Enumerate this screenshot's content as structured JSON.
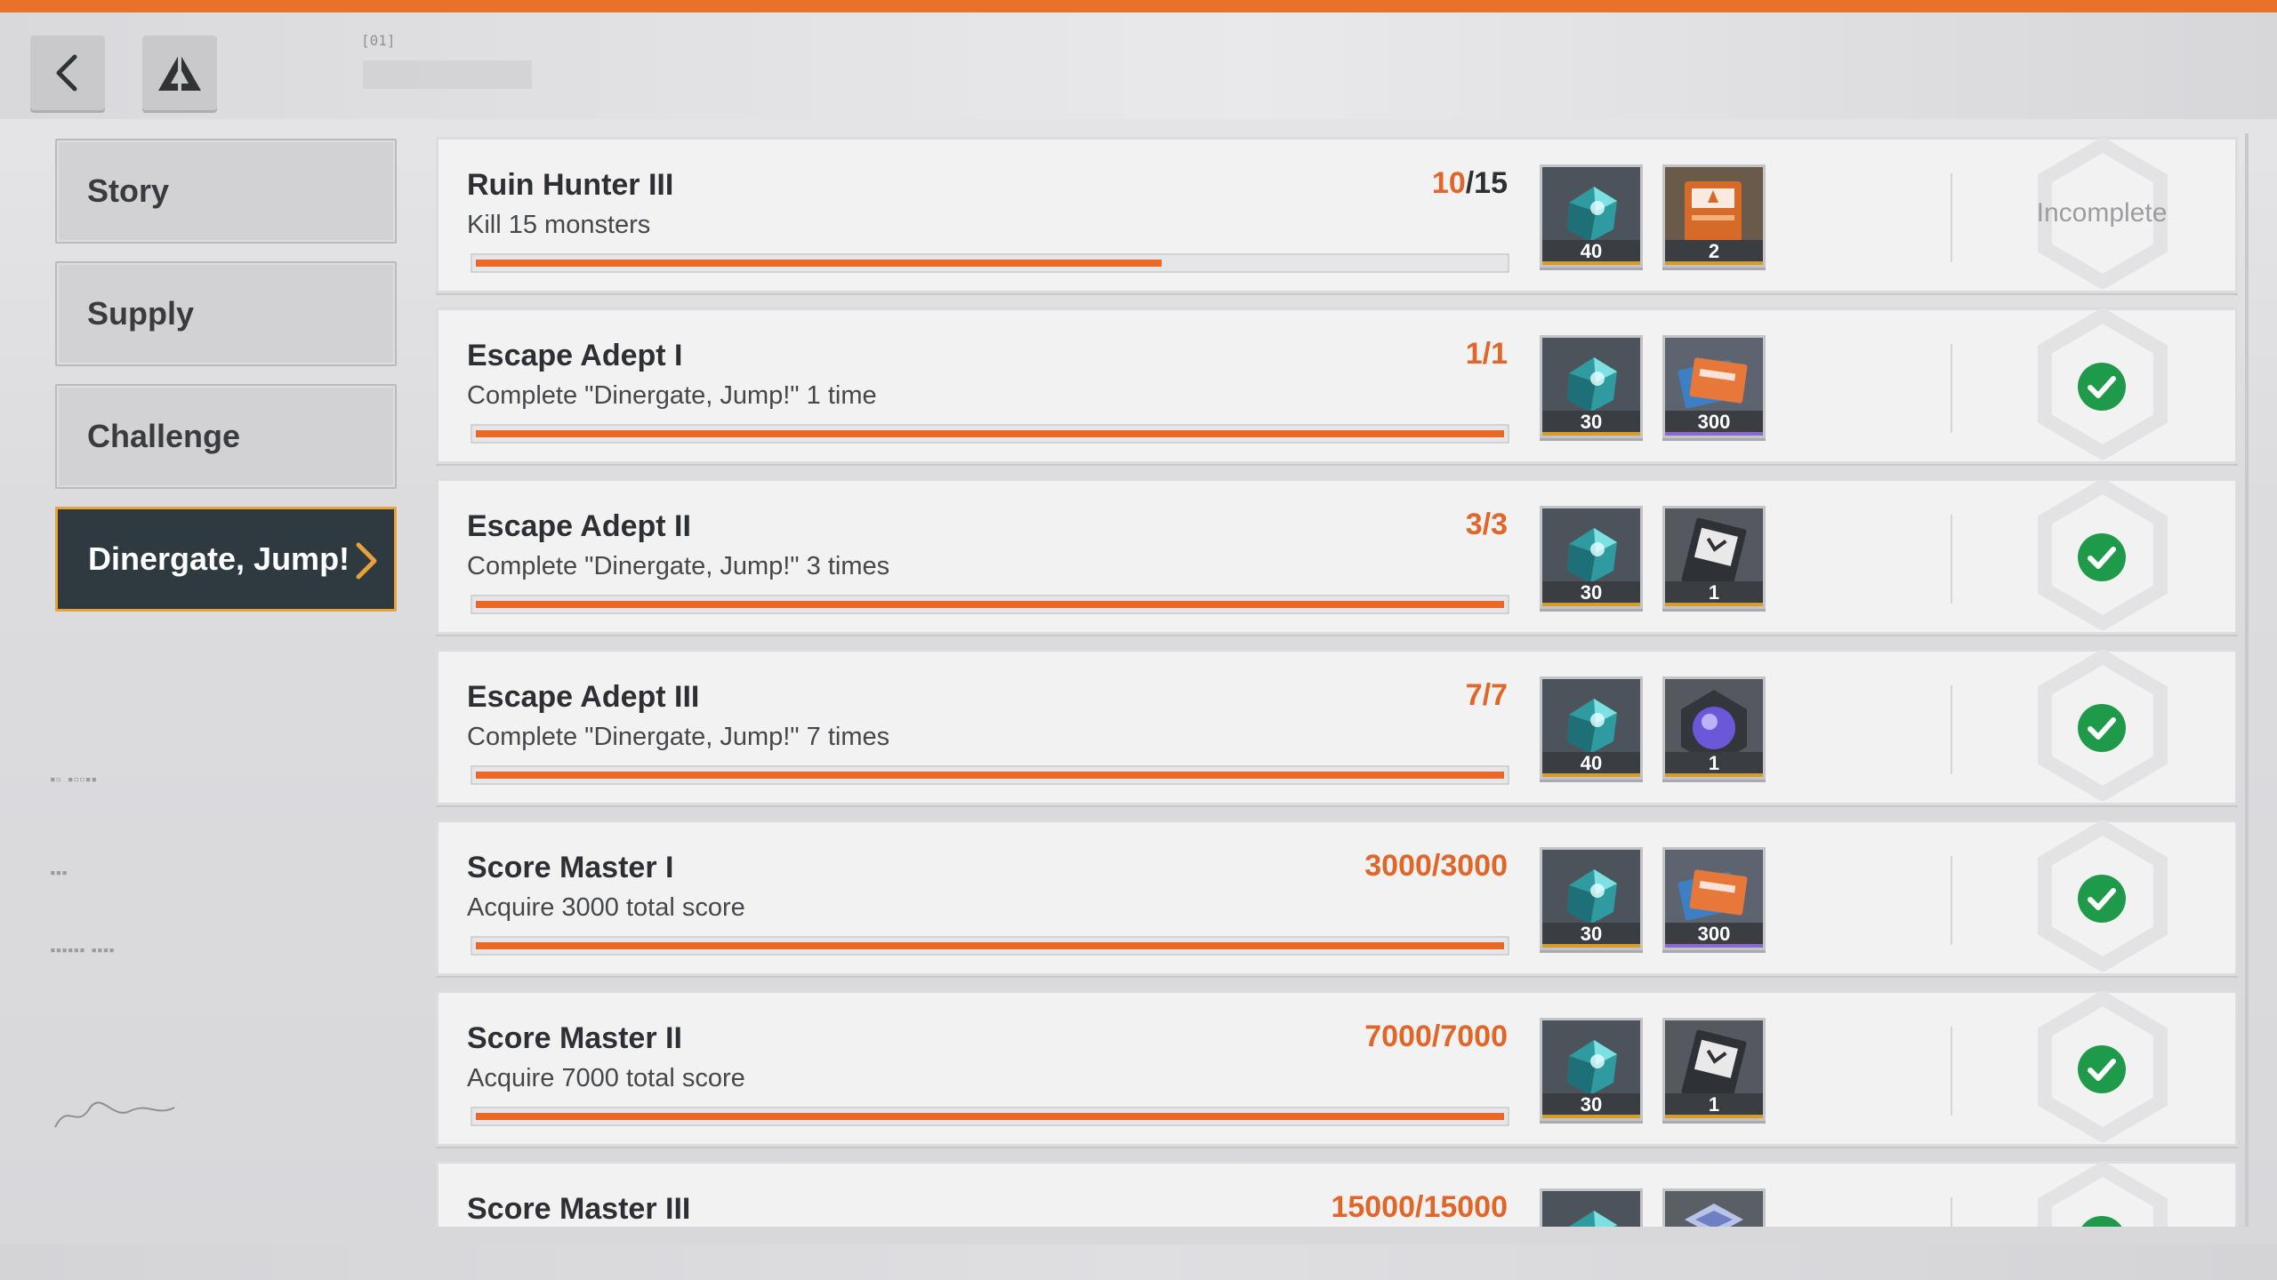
{
  "header": {
    "tag": "[01]"
  },
  "sidebar": {
    "items": [
      {
        "label": "Story",
        "active": false
      },
      {
        "label": "Supply",
        "active": false
      },
      {
        "label": "Challenge",
        "active": false
      },
      {
        "label": "Dinergate, Jump!",
        "active": true
      }
    ]
  },
  "colors": {
    "accent": "#ea6726",
    "complete": "#1f9a4a",
    "active_tab": "#2f3a40",
    "active_border": "#e8a23a"
  },
  "achievements": [
    {
      "title": "Ruin Hunter III",
      "desc": "Kill 15 monsters",
      "current": "10",
      "total": "/15",
      "progress": 0.667,
      "complete": false,
      "rewards": [
        {
          "icon": "crystal-icon",
          "qty": "40"
        },
        {
          "icon": "supply-card-icon",
          "qty": "2"
        }
      ],
      "status": "Incomplete"
    },
    {
      "title": "Escape Adept I",
      "desc": "Complete \"Dinergate, Jump!\" 1 time",
      "current": "1/1",
      "total": "",
      "progress": 1,
      "complete": true,
      "rewards": [
        {
          "icon": "crystal-icon",
          "qty": "30"
        },
        {
          "icon": "ticket-bundle-icon",
          "qty": "300"
        }
      ],
      "status": ""
    },
    {
      "title": "Escape Adept II",
      "desc": "Complete \"Dinergate, Jump!\" 3 times",
      "current": "3/3",
      "total": "",
      "progress": 1,
      "complete": true,
      "rewards": [
        {
          "icon": "crystal-icon",
          "qty": "30"
        },
        {
          "icon": "data-card-icon",
          "qty": "1"
        }
      ],
      "status": ""
    },
    {
      "title": "Escape Adept III",
      "desc": "Complete \"Dinergate, Jump!\" 7 times",
      "current": "7/7",
      "total": "",
      "progress": 1,
      "complete": true,
      "rewards": [
        {
          "icon": "crystal-icon",
          "qty": "40"
        },
        {
          "icon": "core-orb-icon",
          "qty": "1"
        }
      ],
      "status": ""
    },
    {
      "title": "Score Master I",
      "desc": "Acquire 3000 total score",
      "current": "3000/3000",
      "total": "",
      "progress": 1,
      "complete": true,
      "rewards": [
        {
          "icon": "crystal-icon",
          "qty": "30"
        },
        {
          "icon": "ticket-bundle-icon",
          "qty": "300"
        }
      ],
      "status": ""
    },
    {
      "title": "Score Master II",
      "desc": "Acquire 7000 total score",
      "current": "7000/7000",
      "total": "",
      "progress": 1,
      "complete": true,
      "rewards": [
        {
          "icon": "crystal-icon",
          "qty": "30"
        },
        {
          "icon": "data-card-icon",
          "qty": "1"
        }
      ],
      "status": ""
    },
    {
      "title": "Score Master III",
      "desc": "",
      "current": "15000/15000",
      "total": "",
      "progress": 1,
      "complete": true,
      "rewards": [
        {
          "icon": "crystal-icon",
          "qty": ""
        },
        {
          "icon": "emblem-icon",
          "qty": ""
        }
      ],
      "status": ""
    }
  ]
}
